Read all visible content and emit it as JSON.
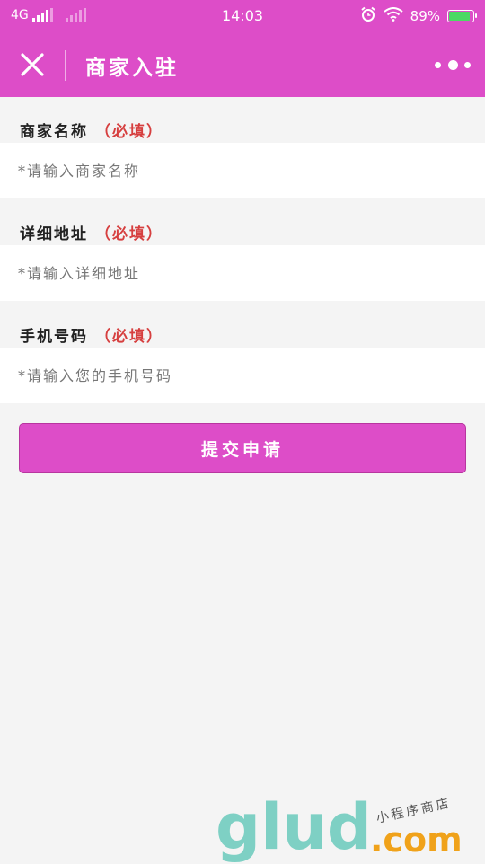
{
  "status_bar": {
    "network": "4G",
    "time": "14:03",
    "battery_text": "89%",
    "battery_level": 0.89
  },
  "nav": {
    "title": "商家入驻"
  },
  "form": {
    "required_text": "（必填）",
    "fields": [
      {
        "label": "商家名称",
        "placeholder": "*请输入商家名称",
        "value": ""
      },
      {
        "label": "详细地址",
        "placeholder": "*请输入详细地址",
        "value": ""
      },
      {
        "label": "手机号码",
        "placeholder": "*请输入您的手机号码",
        "value": ""
      }
    ],
    "submit_label": "提交申请"
  },
  "watermark": {
    "logo": "glud",
    "domain": ".com",
    "tagline": "小程序商店"
  },
  "colors": {
    "brand": "#dd4dc8",
    "required": "#d63f3f",
    "background": "#f4f4f4"
  },
  "icons": [
    "close-icon",
    "more-icon",
    "signal-icon",
    "alarm-icon",
    "wifi-icon",
    "battery-icon"
  ]
}
